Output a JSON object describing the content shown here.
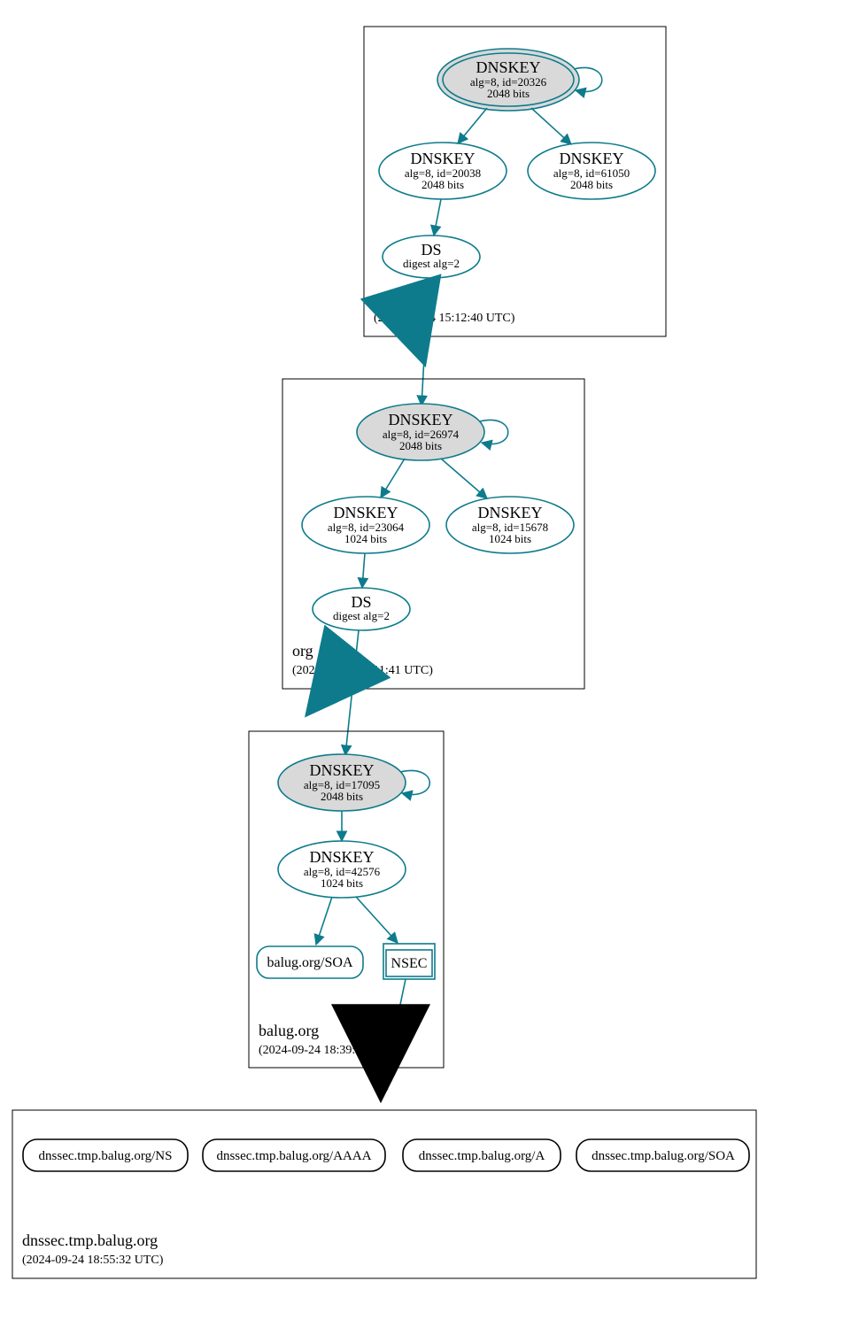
{
  "zones": {
    "root": {
      "name": ".",
      "timestamp": "(2024-09-24 15:12:40 UTC)",
      "dnskey_ksk": {
        "title": "DNSKEY",
        "line1": "alg=8, id=20326",
        "line2": "2048 bits"
      },
      "dnskey_zsk1": {
        "title": "DNSKEY",
        "line1": "alg=8, id=20038",
        "line2": "2048 bits"
      },
      "dnskey_zsk2": {
        "title": "DNSKEY",
        "line1": "alg=8, id=61050",
        "line2": "2048 bits"
      },
      "ds": {
        "title": "DS",
        "line1": "digest alg=2"
      }
    },
    "org": {
      "name": "org",
      "timestamp": "(2024-09-24 17:11:41 UTC)",
      "dnskey_ksk": {
        "title": "DNSKEY",
        "line1": "alg=8, id=26974",
        "line2": "2048 bits"
      },
      "dnskey_zsk1": {
        "title": "DNSKEY",
        "line1": "alg=8, id=23064",
        "line2": "1024 bits"
      },
      "dnskey_zsk2": {
        "title": "DNSKEY",
        "line1": "alg=8, id=15678",
        "line2": "1024 bits"
      },
      "ds": {
        "title": "DS",
        "line1": "digest alg=2"
      }
    },
    "balug": {
      "name": "balug.org",
      "timestamp": "(2024-09-24 18:39:11 UTC)",
      "dnskey_ksk": {
        "title": "DNSKEY",
        "line1": "alg=8, id=17095",
        "line2": "2048 bits"
      },
      "dnskey_zsk": {
        "title": "DNSKEY",
        "line1": "alg=8, id=42576",
        "line2": "1024 bits"
      },
      "soa": {
        "label": "balug.org/SOA"
      },
      "nsec": {
        "label": "NSEC"
      }
    },
    "dnssec_tmp": {
      "name": "dnssec.tmp.balug.org",
      "timestamp": "(2024-09-24 18:55:32 UTC)",
      "records": {
        "ns": "dnssec.tmp.balug.org/NS",
        "aaaa": "dnssec.tmp.balug.org/AAAA",
        "a": "dnssec.tmp.balug.org/A",
        "soa": "dnssec.tmp.balug.org/SOA"
      }
    }
  },
  "colors": {
    "teal": "#0e7b8c",
    "gray_fill": "#d9d9d9"
  }
}
